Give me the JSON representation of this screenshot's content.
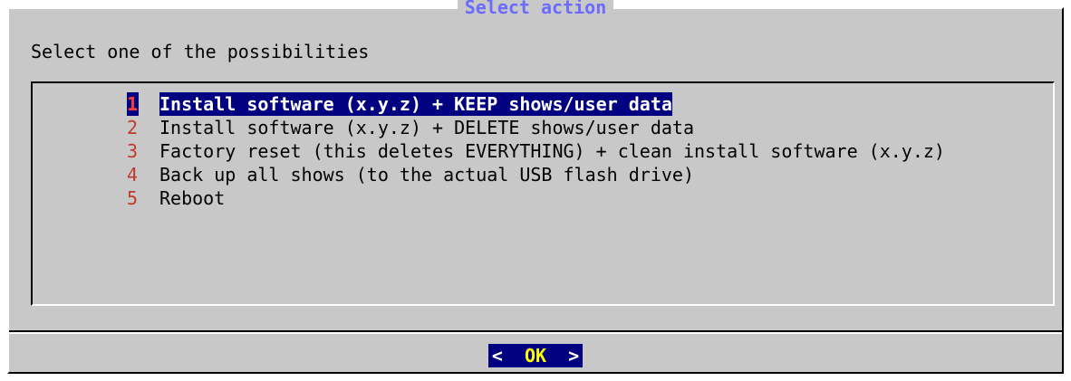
{
  "dialog": {
    "title": "Select action",
    "prompt": "Select one of the possibilities"
  },
  "menu": {
    "items": [
      {
        "num": "1",
        "label": "Install software (x.y.z) + KEEP shows/user data",
        "selected": true
      },
      {
        "num": "2",
        "label": "Install software (x.y.z) + DELETE shows/user data",
        "selected": false
      },
      {
        "num": "3",
        "label": "Factory reset (this deletes EVERYTHING) + clean install software (x.y.z)",
        "selected": false
      },
      {
        "num": "4",
        "label": "Back up all shows (to the actual USB flash drive)",
        "selected": false
      },
      {
        "num": "5",
        "label": "Reboot",
        "selected": false
      }
    ]
  },
  "buttons": {
    "ok_left": "<",
    "ok_label": "OK",
    "ok_right": ">"
  },
  "colors": {
    "dialog_bg": "#c8c8c8",
    "title": "#6b6bff",
    "selection_bg": "#000080",
    "hotkey": "#c0392b",
    "ok_text": "#ffff00"
  }
}
